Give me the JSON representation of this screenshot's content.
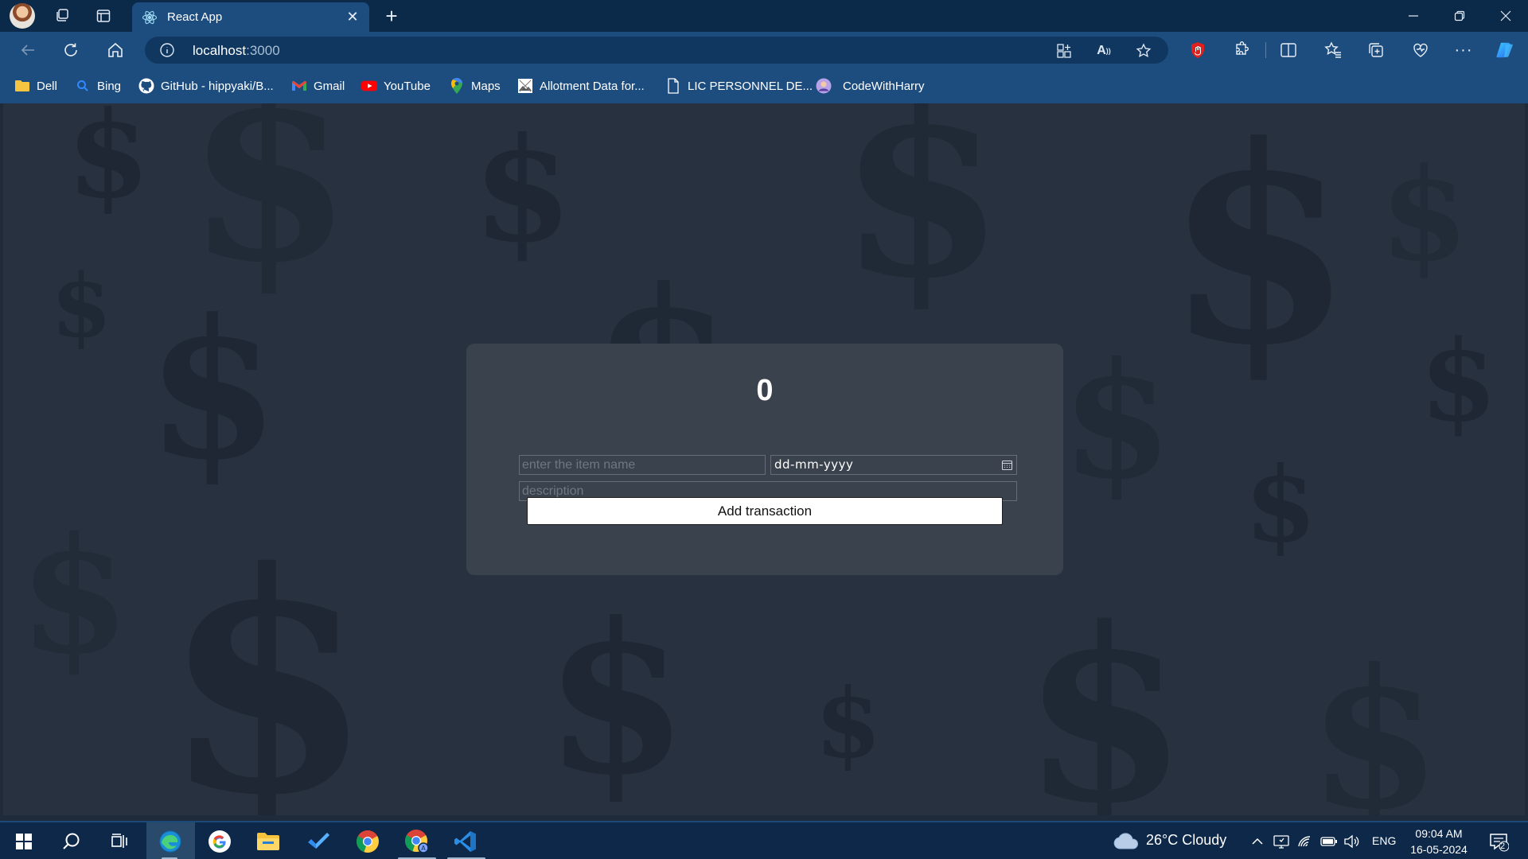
{
  "browser": {
    "tab": {
      "title": "React App"
    },
    "address": {
      "host": "localhost",
      "port": ":3000"
    },
    "bookmarks": [
      {
        "label": "Dell",
        "icon": "folder-icon"
      },
      {
        "label": "Bing",
        "icon": "bing-icon"
      },
      {
        "label": "GitHub - hippyaki/B...",
        "icon": "github-icon"
      },
      {
        "label": "Gmail",
        "icon": "gmail-icon"
      },
      {
        "label": "YouTube",
        "icon": "youtube-icon"
      },
      {
        "label": "Maps",
        "icon": "maps-icon"
      },
      {
        "label": "Allotment Data for...",
        "icon": "image-icon"
      },
      {
        "label": "LIC PERSONNEL DE...",
        "icon": "document-icon"
      },
      {
        "label": "CodeWithHarry",
        "icon": "codewithharry-icon"
      }
    ]
  },
  "app": {
    "balance": "0",
    "item_placeholder": "enter the item name",
    "date_placeholder": "dd-mm-yyyy",
    "description_placeholder": "description",
    "add_button": "Add transaction"
  },
  "taskbar": {
    "weather": "26°C Cloudy",
    "language": "ENG",
    "time": "09:04 AM",
    "date": "16-05-2024",
    "notifications": "2"
  },
  "colors": {
    "titlebar": "#0b2a4a",
    "toolbar": "#1d4d7f",
    "page_bg": "#27313f",
    "card_bg": "#3a424d",
    "taskbar": "#0d2848"
  }
}
